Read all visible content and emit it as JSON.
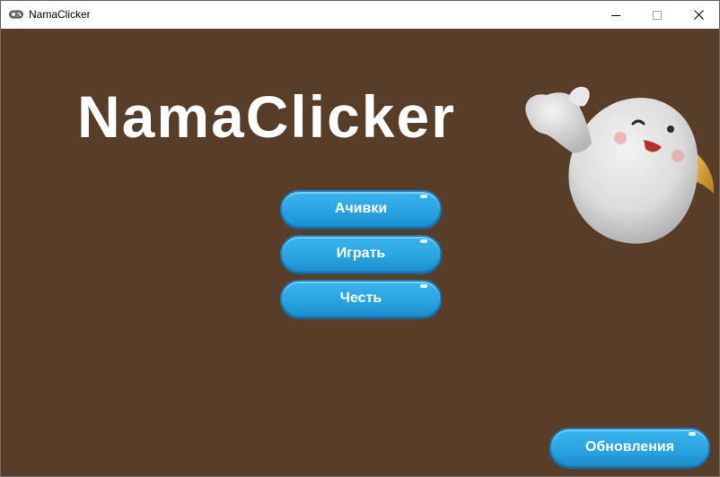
{
  "window": {
    "title": "NamaClicker",
    "app_icon": "gamepad-icon",
    "controls": [
      "minimize-icon",
      "maximize-icon",
      "close-icon"
    ]
  },
  "game": {
    "title": "NamaClicker",
    "mascot": "mascot-image"
  },
  "menu": {
    "achievements_label": "Ачивки",
    "play_label": "Играть",
    "honor_label": "Честь",
    "updates_label": "Обновления"
  },
  "colors": {
    "background": "#583d28",
    "button": "#2aa5e3",
    "title_text": "#ffffff"
  }
}
